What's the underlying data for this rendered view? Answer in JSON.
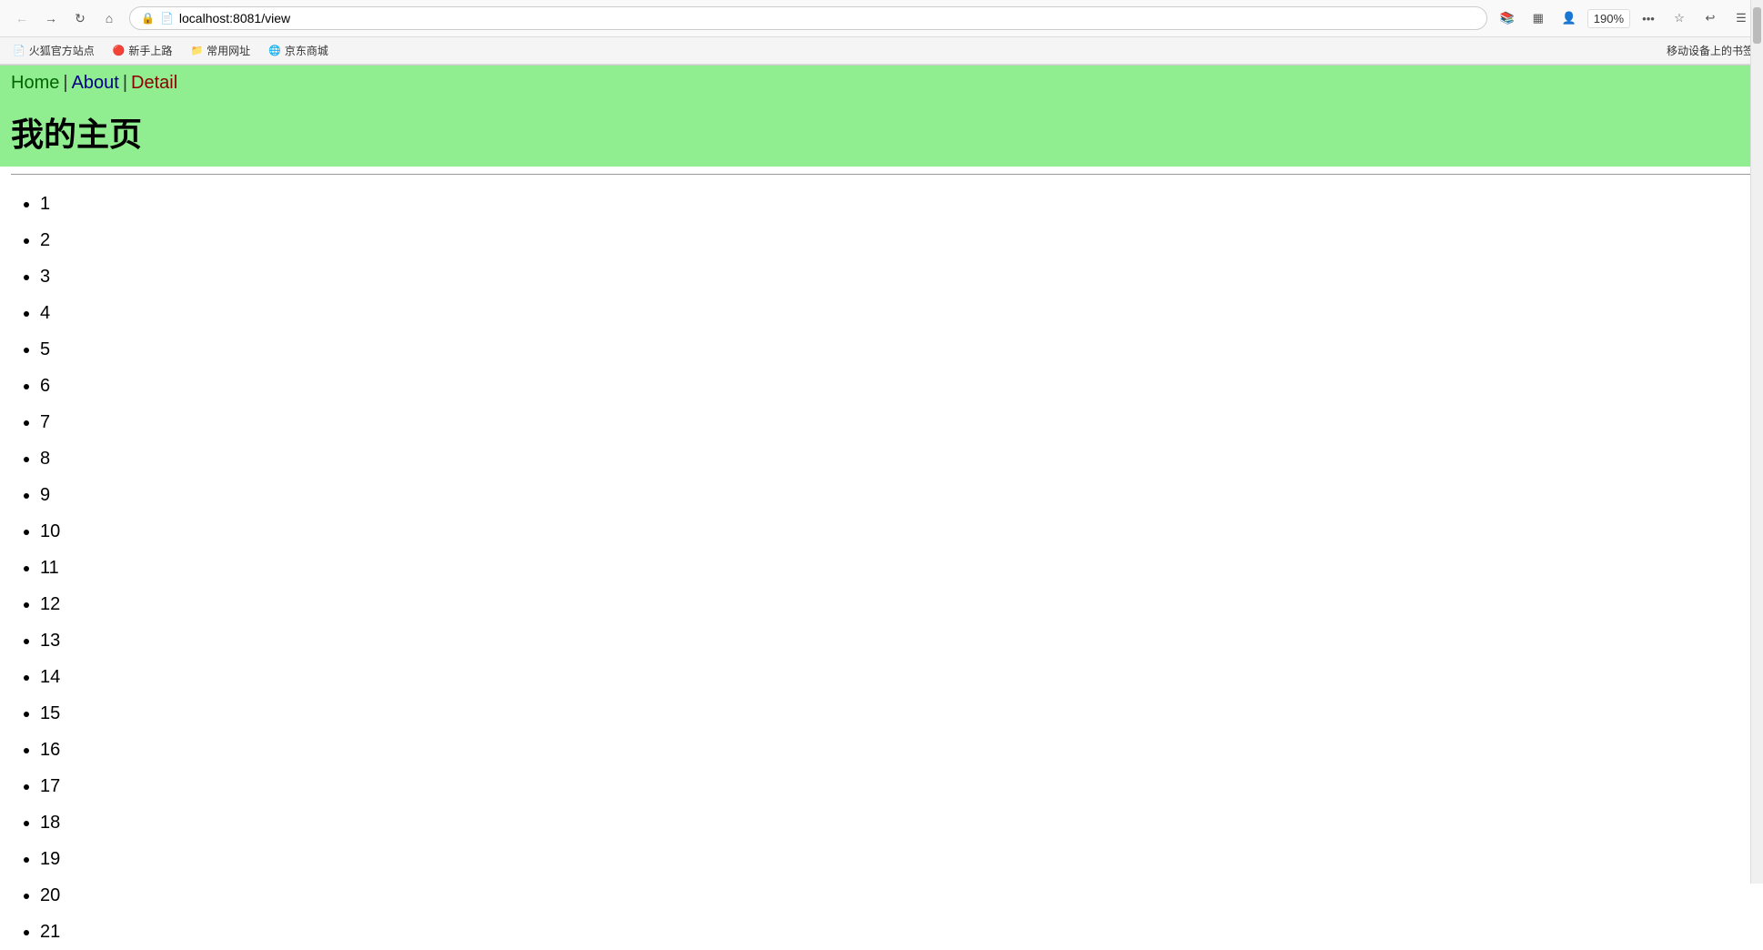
{
  "browser": {
    "url": "localhost:8081/view",
    "zoom": "190%",
    "nav": {
      "back_label": "←",
      "forward_label": "→",
      "refresh_label": "↻",
      "home_label": "⌂"
    },
    "bookmarks": [
      {
        "icon": "📄",
        "label": "火狐官方站点"
      },
      {
        "icon": "🔴",
        "label": "新手上路"
      },
      {
        "icon": "📁",
        "label": "常用网址"
      },
      {
        "icon": "🌐",
        "label": "京东商城"
      }
    ],
    "mobile_bookmarks_label": "移动设备上的书签",
    "toolbar_icons": {
      "library": "📚",
      "sidebar": "▦",
      "account": "👤",
      "customize": "⚙",
      "undo": "↩",
      "menu": "☰"
    }
  },
  "page": {
    "nav": {
      "home_label": "Home",
      "separator1": "|",
      "about_label": "About",
      "separator2": "|",
      "detail_label": "Detail"
    },
    "title": "我的主页",
    "list_items": [
      "1",
      "2",
      "3",
      "4",
      "5",
      "6",
      "7",
      "8",
      "9",
      "10",
      "11",
      "12",
      "13",
      "14",
      "15",
      "16",
      "17",
      "18",
      "19",
      "20",
      "21"
    ]
  }
}
